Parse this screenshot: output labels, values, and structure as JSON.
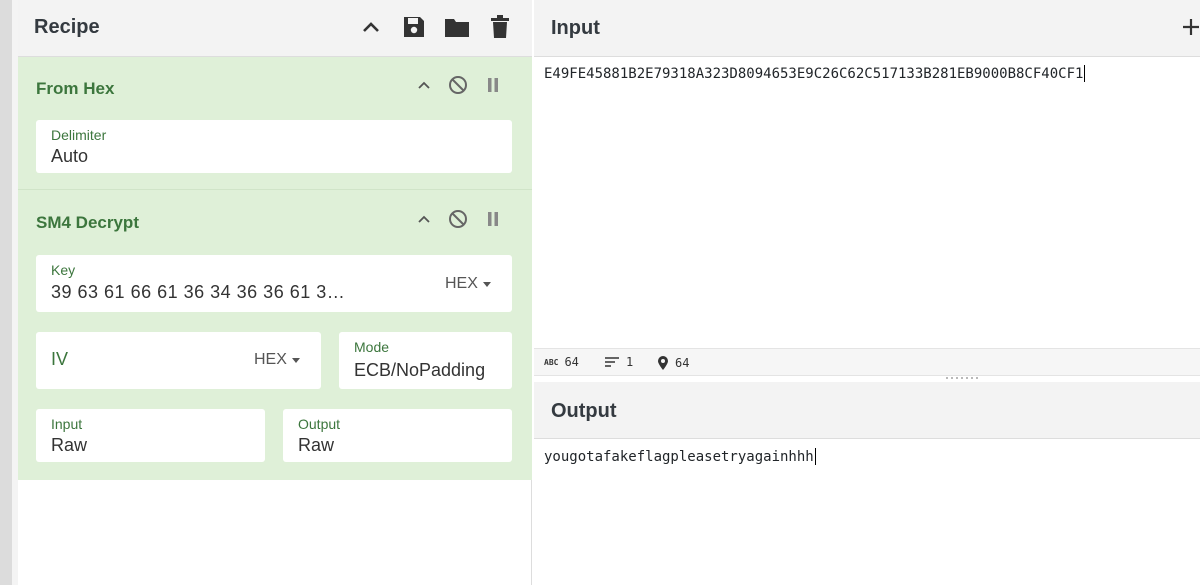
{
  "recipe": {
    "title": "Recipe",
    "icons": [
      "chevron-up-icon",
      "save-icon",
      "folder-icon",
      "trash-icon"
    ],
    "operations": [
      {
        "name": "From Hex",
        "fields": {
          "delimiter": {
            "label": "Delimiter",
            "value": "Auto"
          }
        }
      },
      {
        "name": "SM4 Decrypt",
        "fields": {
          "key": {
            "label": "Key",
            "value": "39 63 61 66 61 36 34 36 36 61 3…",
            "format": "HEX"
          },
          "iv": {
            "label": "IV",
            "format": "HEX"
          },
          "mode": {
            "label": "Mode",
            "value": "ECB/NoPadding"
          },
          "input": {
            "label": "Input",
            "value": "Raw"
          },
          "output": {
            "label": "Output",
            "value": "Raw"
          }
        }
      }
    ]
  },
  "input": {
    "title": "Input",
    "text": "E49FE45881B2E79318A323D8094653E9C26C62C517133B281EB9000B8CF40CF1"
  },
  "status": {
    "chars": "64",
    "lines": "1",
    "position": "64"
  },
  "output": {
    "title": "Output",
    "text": "yougotafakeflagpleasetryagainhhh"
  },
  "colors": {
    "op_background": "#dff0d8",
    "op_title": "#3c763d",
    "header_background": "#f3f3f3"
  }
}
